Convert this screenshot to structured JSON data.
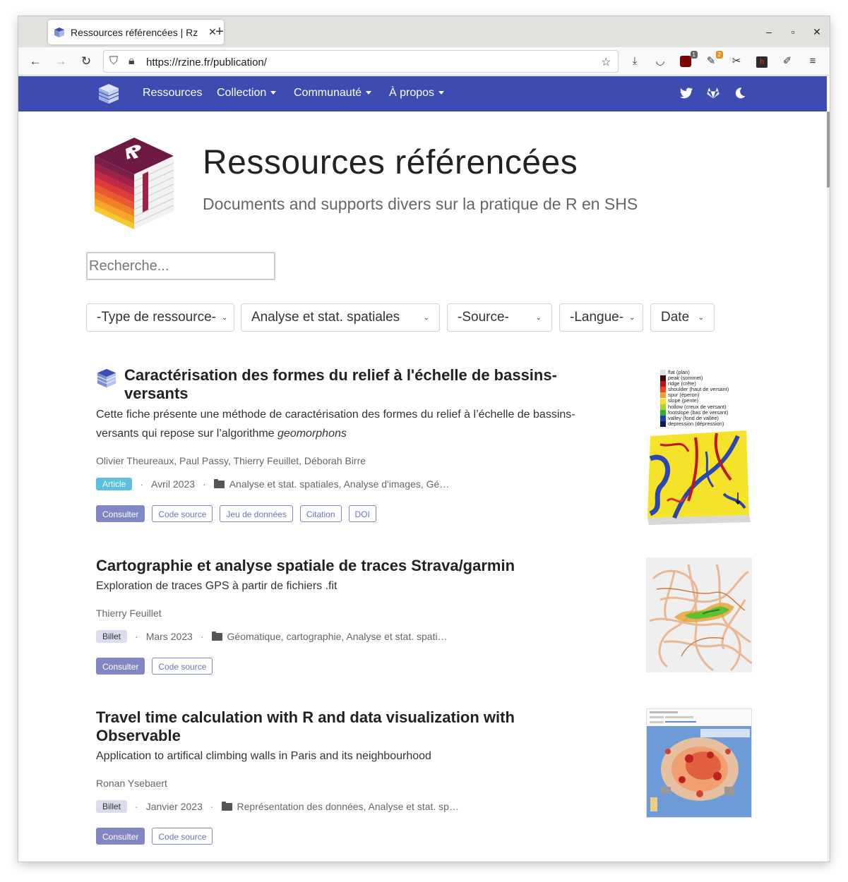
{
  "browser": {
    "tab_title": "Ressources référencées | Rzine",
    "url": "https://rzine.fr/publication/",
    "extension_badges": {
      "ublock": "1",
      "ext2": "2"
    }
  },
  "site_nav": {
    "items": [
      {
        "label": "Ressources",
        "dropdown": false
      },
      {
        "label": "Collection",
        "dropdown": true
      },
      {
        "label": "Communauté",
        "dropdown": true
      },
      {
        "label": "À propos",
        "dropdown": true
      }
    ],
    "icons": [
      "twitter-icon",
      "gitlab-icon",
      "moon-icon"
    ],
    "background": "#3e4bb1"
  },
  "hero": {
    "title": "Ressources référencées",
    "subtitle": "Documents and supports divers sur la pratique de R en SHS"
  },
  "search": {
    "placeholder": "Recherche..."
  },
  "filters": {
    "type": "-Type de ressource-",
    "theme": "Analyse et stat. spatiales",
    "source": "-Source-",
    "langue": "-Langue-",
    "date": "Date"
  },
  "cards": [
    {
      "title_line1": "Caractérisation des formes du relief à l'échelle de bassins-",
      "title_line2": "versants",
      "desc_line1": "Cette fiche présente une méthode de caractérisation des formes du relief à l’échelle de bassins-",
      "desc_line2_text": "versants qui repose sur l’algorithme ",
      "desc_line2_em": "geomorphons",
      "authors": "Olivier Theureaux, Paul Passy, Thierry Feuillet, Déborah Birre",
      "type": "Article",
      "date": "Avril 2023",
      "categories": "Analyse et stat. spatiales, Analyse d'images, Gé…",
      "buttons": [
        "Consulter",
        "Code source",
        "Jeu de données",
        "Citation",
        "DOI"
      ],
      "legend": [
        "flat (plan)",
        "peak (sommet)",
        "ridge (crête)",
        "shoulder (haut de versant)",
        "spur (éperon)",
        "slope (pente)",
        "hollow (creux de versant)",
        "footslope (bas de versant)",
        "valley (fond de vallée)",
        "depression (dépression)"
      ]
    },
    {
      "title_line1": "Cartographie et analyse spatiale de traces Strava/garmin",
      "desc_line1": "Exploration de traces GPS à partir de fichiers .fit",
      "authors": "Thierry Feuillet",
      "type": "Billet",
      "date": "Mars 2023",
      "categories": "Géomatique, cartographie, Analyse et stat. spati…",
      "buttons": [
        "Consulter",
        "Code source"
      ]
    },
    {
      "title_line1": "Travel time calculation with R and data visualization with",
      "title_line2": "Observable",
      "desc_line1": "Application to artifical climbing walls in Paris and its neighbourhood",
      "authors": "Ronan Ysebaert",
      "type": "Billet",
      "date": "Janvier 2023",
      "categories": "Représentation des données, Analyse et stat. sp…",
      "buttons": [
        "Consulter",
        "Code source"
      ]
    }
  ]
}
